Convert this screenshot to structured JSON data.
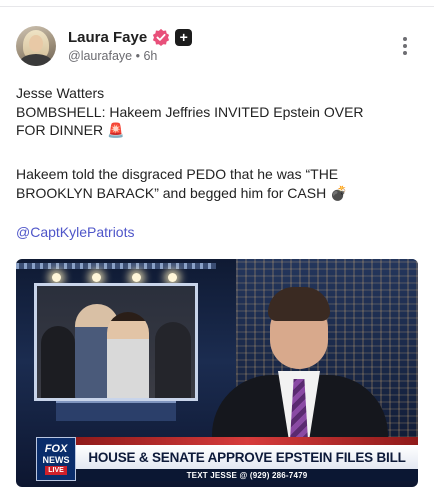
{
  "post": {
    "author": {
      "display_name": "Laura Faye",
      "handle": "@laurafaye",
      "separator": "•",
      "age": "6h",
      "verified_color": "#e8507a"
    },
    "text_lines_1": [
      "Jesse Watters",
      "BOMBSHELL: Hakeem Jeffries INVITED Epstein OVER",
      "FOR DINNER 🚨"
    ],
    "text_lines_2": [
      "Hakeem told the disgraced PEDO that he was “THE",
      "BROOKLYN BARACK” and begged him for CASH 💣"
    ],
    "mention": "@CaptKylePatriots",
    "media": {
      "logo": {
        "line1": "FOX",
        "line2": "NEWS",
        "line3": "LIVE"
      },
      "headline": "HOUSE & SENATE APPROVE EPSTEIN FILES BILL",
      "subtext": "TEXT JESSE @ (929) 286-7479"
    }
  },
  "colors": {
    "link": "#4f56c9",
    "text": "#222222",
    "muted": "#6b6b70"
  }
}
